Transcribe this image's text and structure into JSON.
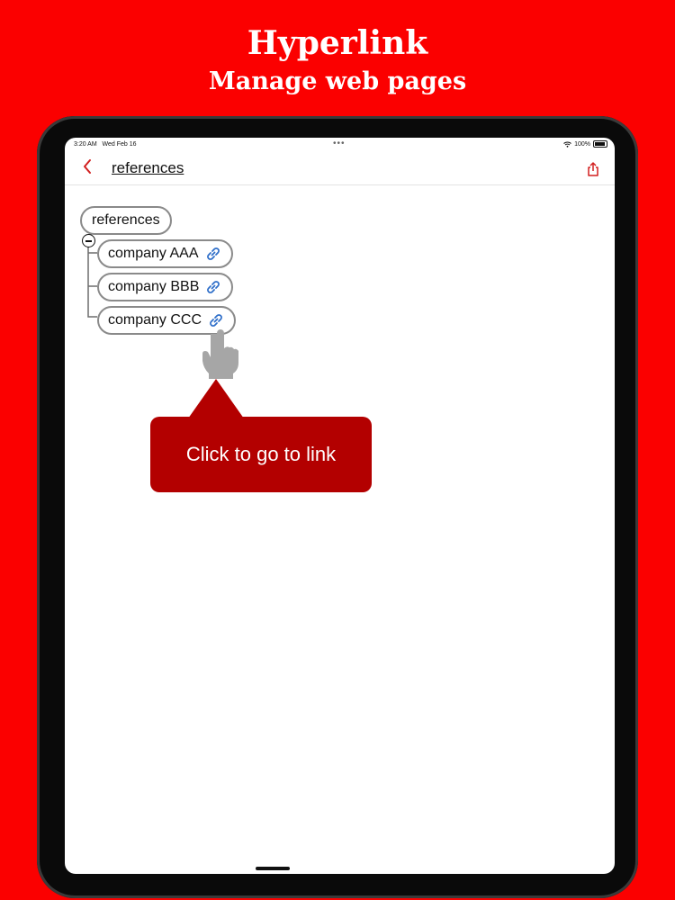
{
  "promo": {
    "title": "Hyperlink",
    "subtitle": "Manage web pages"
  },
  "status_bar": {
    "time": "3:20 AM",
    "date": "Wed Feb 16",
    "dots": "•••",
    "battery": "100%"
  },
  "nav": {
    "title": "references",
    "back_icon": "chevron-left-icon",
    "share_icon": "share-icon"
  },
  "tree": {
    "root": "references",
    "children": [
      {
        "label": "company AAA",
        "icon": "link-icon"
      },
      {
        "label": "company BBB",
        "icon": "link-icon"
      },
      {
        "label": "company CCC",
        "icon": "link-icon"
      }
    ]
  },
  "callout": {
    "text": "Click to go to link"
  },
  "colors": {
    "background": "#fb0000",
    "accent": "#d21f1f",
    "link": "#2f6fc9",
    "callout": "#b30000"
  }
}
